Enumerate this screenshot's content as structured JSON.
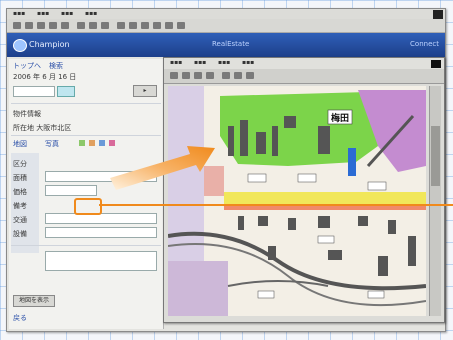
{
  "header": {
    "logo_text": "Champion",
    "center_text": "RealEstate",
    "right_text": "Connect"
  },
  "left_panel": {
    "title": "2006 年 6 月 16 日",
    "section1": "物件情報",
    "section2": "所在地 大阪市北区",
    "links": [
      "トップへ",
      "検索",
      "地図",
      "写真"
    ],
    "labels": [
      "区分",
      "面積",
      "価格",
      "備考",
      "交通",
      "設備"
    ],
    "bottom_button": "地図を表示",
    "footer_link": "戻る"
  },
  "map_window": {
    "map_label": "梅田"
  },
  "colors": {
    "header": "#2f5fb8",
    "arrow": "#f08a1c",
    "map_green": "#7cd44a",
    "map_purple": "#c48cd0",
    "map_yellow": "#f1e75a",
    "map_blue_marker": "#2a6bd4"
  },
  "icons": [
    "logo-icon",
    "arrow-icon",
    "close-icon",
    "map-marker-icon"
  ]
}
